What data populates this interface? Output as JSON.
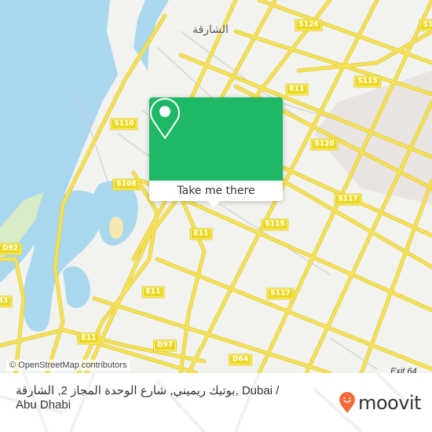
{
  "map": {
    "city_label": "الشارقة",
    "exit_label": "Exit 64",
    "attribution": "© OpenStreetMap contributors",
    "road_labels": [
      {
        "text": "S126",
        "id": "s126-center"
      },
      {
        "text": "S1",
        "id": "s126-right"
      },
      {
        "text": "S115",
        "id": "s115-top"
      },
      {
        "text": "E11",
        "id": "e11-top"
      },
      {
        "text": "S110",
        "id": "s110"
      },
      {
        "text": "S120",
        "id": "s120"
      },
      {
        "text": "S108",
        "id": "s108"
      },
      {
        "text": "S117",
        "id": "s117-top"
      },
      {
        "text": "E11",
        "id": "e11-mid"
      },
      {
        "text": "S115",
        "id": "s115-mid"
      },
      {
        "text": "D92",
        "id": "d92"
      },
      {
        "text": "E11",
        "id": "e11-low"
      },
      {
        "text": "S117",
        "id": "s117-mid"
      },
      {
        "text": "43",
        "id": "r43"
      },
      {
        "text": "E11",
        "id": "e11-bottom"
      },
      {
        "text": "D97",
        "id": "d97"
      },
      {
        "text": "D64",
        "id": "d64"
      }
    ],
    "colors": {
      "land": "#f2f2ef",
      "water": "#a9d8ee",
      "road": "#f5e15a",
      "road_casing": "#e3cf3e",
      "minor_road": "#cfcfcf",
      "park": "#d9ebc6",
      "industrial": "#e9e4e2"
    }
  },
  "popup": {
    "action_label": "Take me there",
    "icon": "map-pin-icon",
    "color": "#1fb866"
  },
  "footer": {
    "address": "بوتيك ريميني, شارع الوحدة المجاز 2, الشارقة, Dubai / Abu Dhabi",
    "brand": "moovit",
    "brand_color": "#f26a3c"
  }
}
